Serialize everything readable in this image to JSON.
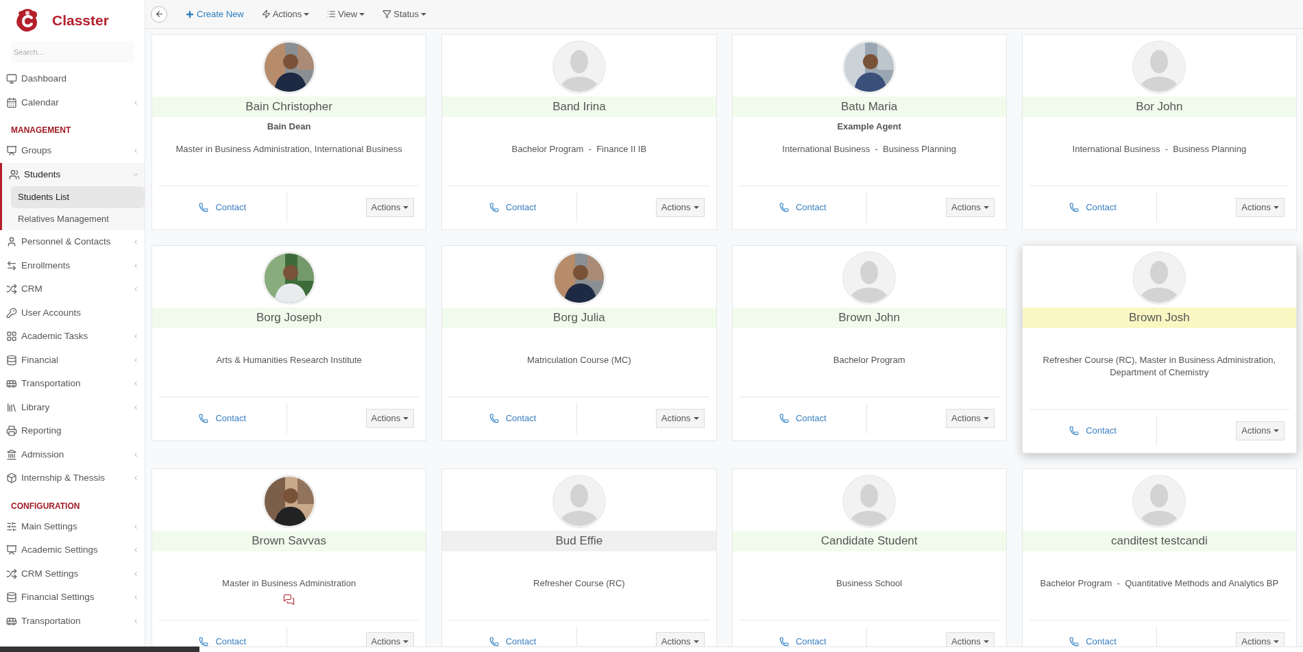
{
  "brand": {
    "name": "Classter"
  },
  "search": {
    "placeholder": "Search..."
  },
  "sidebar": {
    "sections": [
      {
        "items": [
          {
            "label": "Dashboard"
          },
          {
            "label": "Calendar",
            "expanded": false
          }
        ]
      },
      {
        "heading": "MANAGEMENT",
        "items": [
          {
            "label": "Groups",
            "expanded": false
          },
          {
            "label": "Students",
            "expanded": true,
            "children": [
              {
                "label": "Students List",
                "selected": true
              },
              {
                "label": "Relatives Management",
                "selected": false
              }
            ]
          },
          {
            "label": "Personnel & Contacts",
            "expanded": false
          },
          {
            "label": "Enrollments",
            "expanded": false
          },
          {
            "label": "CRM",
            "expanded": false
          },
          {
            "label": "User Accounts"
          },
          {
            "label": "Academic Tasks",
            "expanded": false
          },
          {
            "label": "Financial",
            "expanded": false
          },
          {
            "label": "Transportation",
            "expanded": false
          },
          {
            "label": "Library",
            "expanded": false
          },
          {
            "label": "Reporting"
          },
          {
            "label": "Admission",
            "expanded": false
          },
          {
            "label": "Internship & Thessis",
            "expanded": false
          }
        ]
      },
      {
        "heading": "CONFIGURATION",
        "items": [
          {
            "label": "Main Settings",
            "expanded": false
          },
          {
            "label": "Academic Settings",
            "expanded": false
          },
          {
            "label": "CRM Settings",
            "expanded": false
          },
          {
            "label": "Financial Settings",
            "expanded": false
          },
          {
            "label": "Transportation",
            "expanded": false
          }
        ]
      }
    ]
  },
  "toolbar": {
    "buttons": [
      {
        "kind": "back"
      },
      {
        "kind": "create",
        "label": "Create New"
      },
      {
        "kind": "menu",
        "label": "Actions"
      },
      {
        "kind": "menu",
        "label": "View"
      },
      {
        "kind": "menu",
        "label": "Status"
      }
    ]
  },
  "cards": [
    {
      "name": "Bain Christopher",
      "subtitle": "Bain Dean",
      "program": "Master in Business Administration, International Business",
      "color": "#f1fbeb",
      "elevated": false,
      "comments": false,
      "contact": "Contact",
      "actions": "Actions"
    },
    {
      "name": "Band Irina",
      "program": "Bachelor Program  -  Finance II IB",
      "kind": "placeholder",
      "color": "#f1fbeb",
      "elevated": false,
      "comments": false,
      "contact": "Contact",
      "actions": "Actions"
    },
    {
      "name": "Batu Maria",
      "subtitle": "Example Agent",
      "program": "International Business  -  Business Planning",
      "color": "#f1fbeb",
      "elevated": false,
      "comments": false,
      "contact": "Contact",
      "actions": "Actions"
    },
    {
      "name": "Bor John",
      "program": "International Business  -  Business Planning",
      "kind": "placeholder",
      "color": "#f1fbeb",
      "elevated": false,
      "comments": false,
      "contact": "Contact",
      "actions": "Actions"
    },
    {
      "name": "Borg Joseph",
      "program": "Arts & Humanities Research Institute",
      "color": "#f1fbeb",
      "elevated": false,
      "comments": false,
      "contact": "Contact",
      "actions": "Actions"
    },
    {
      "name": "Borg Julia",
      "program": "Matriculation Course (MC)",
      "color": "#f1fbeb",
      "elevated": false,
      "comments": false,
      "contact": "Contact",
      "actions": "Actions"
    },
    {
      "name": "Brown John",
      "program": "Bachelor Program",
      "kind": "placeholder",
      "color": "#f1fbeb",
      "elevated": false,
      "comments": false,
      "contact": "Contact",
      "actions": "Actions"
    },
    {
      "name": "Brown Josh",
      "program": "Refresher Course (RC), Master in Business Administration, Department of Chemistry",
      "kind": "placeholder",
      "color": "#faf7c3",
      "elevated": true,
      "comments": false,
      "contact": "Contact",
      "actions": "Actions"
    },
    {
      "name": "Brown Savvas",
      "program": "Master in Business Administration",
      "color": "#f1fbeb",
      "elevated": false,
      "comments": true,
      "contact": "Contact",
      "actions": "Actions"
    },
    {
      "name": "Bud Effie",
      "program": "Refresher Course (RC)",
      "kind": "placeholder",
      "color": "#f0f0f0",
      "elevated": false,
      "comments": false,
      "contact": "Contact",
      "actions": "Actions"
    },
    {
      "name": "Candidate Student",
      "program": "Business School",
      "kind": "placeholder",
      "color": "#f1fbeb",
      "elevated": false,
      "comments": false,
      "contact": "Contact",
      "actions": "Actions"
    },
    {
      "name": "canditest testcandi",
      "program": "Bachelor Program  -  Quantitative Methods and Analytics BP",
      "kind": "placeholder",
      "color": "#f1fbeb",
      "elevated": false,
      "comments": false,
      "contact": "Contact",
      "actions": "Actions"
    }
  ]
}
